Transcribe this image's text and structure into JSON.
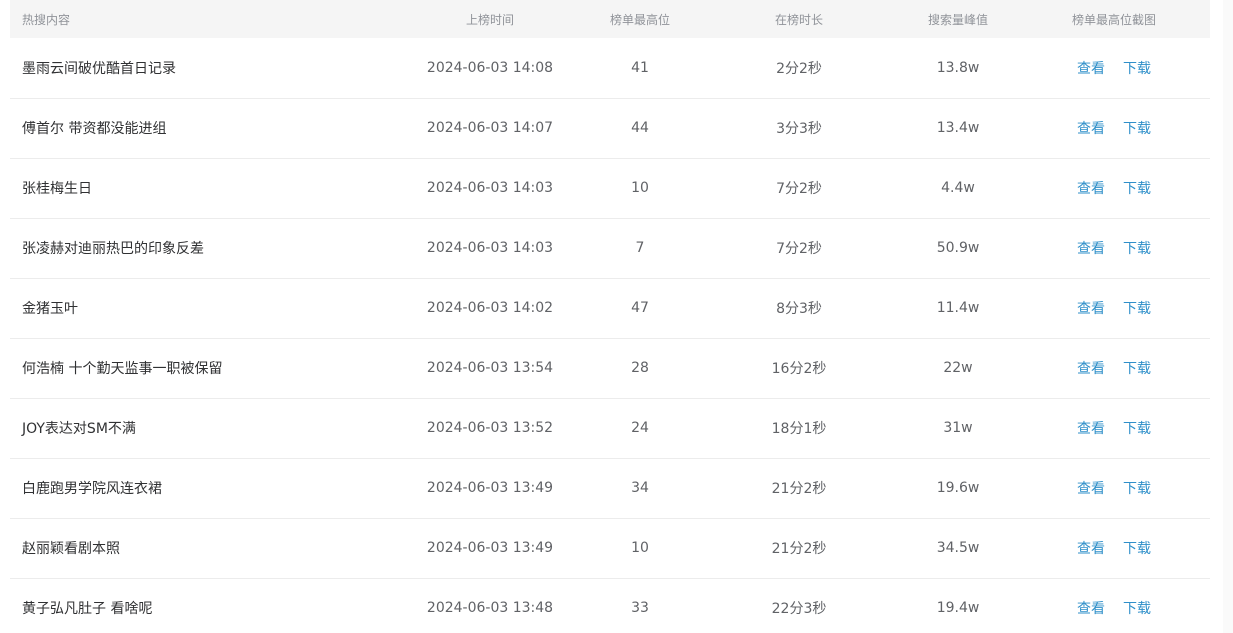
{
  "columns": {
    "title": "热搜内容",
    "time": "上榜时间",
    "top_rank": "榜单最高位",
    "duration": "在榜时长",
    "search_peak": "搜索量峰值",
    "screenshot": "榜单最高位截图"
  },
  "actions": {
    "view": "查看",
    "download": "下载"
  },
  "rows": [
    {
      "title": "墨雨云间破优酷首日记录",
      "time": "2024-06-03 14:08",
      "rank": "41",
      "duration": "2分2秒",
      "peak": "13.8w"
    },
    {
      "title": "傅首尔 带资都没能进组",
      "time": "2024-06-03 14:07",
      "rank": "44",
      "duration": "3分3秒",
      "peak": "13.4w"
    },
    {
      "title": "张桂梅生日",
      "time": "2024-06-03 14:03",
      "rank": "10",
      "duration": "7分2秒",
      "peak": "4.4w"
    },
    {
      "title": "张凌赫对迪丽热巴的印象反差",
      "time": "2024-06-03 14:03",
      "rank": "7",
      "duration": "7分2秒",
      "peak": "50.9w"
    },
    {
      "title": "金猪玉叶",
      "time": "2024-06-03 14:02",
      "rank": "47",
      "duration": "8分3秒",
      "peak": "11.4w"
    },
    {
      "title": "何浩楠 十个勤天监事一职被保留",
      "time": "2024-06-03 13:54",
      "rank": "28",
      "duration": "16分2秒",
      "peak": "22w"
    },
    {
      "title": "JOY表达对SM不满",
      "time": "2024-06-03 13:52",
      "rank": "24",
      "duration": "18分1秒",
      "peak": "31w"
    },
    {
      "title": "白鹿跑男学院风连衣裙",
      "time": "2024-06-03 13:49",
      "rank": "34",
      "duration": "21分2秒",
      "peak": "19.6w"
    },
    {
      "title": "赵丽颖看剧本照",
      "time": "2024-06-03 13:49",
      "rank": "10",
      "duration": "21分2秒",
      "peak": "34.5w"
    },
    {
      "title": "黄子弘凡肚子 看啥呢",
      "time": "2024-06-03 13:48",
      "rank": "33",
      "duration": "22分3秒",
      "peak": "19.4w"
    }
  ]
}
